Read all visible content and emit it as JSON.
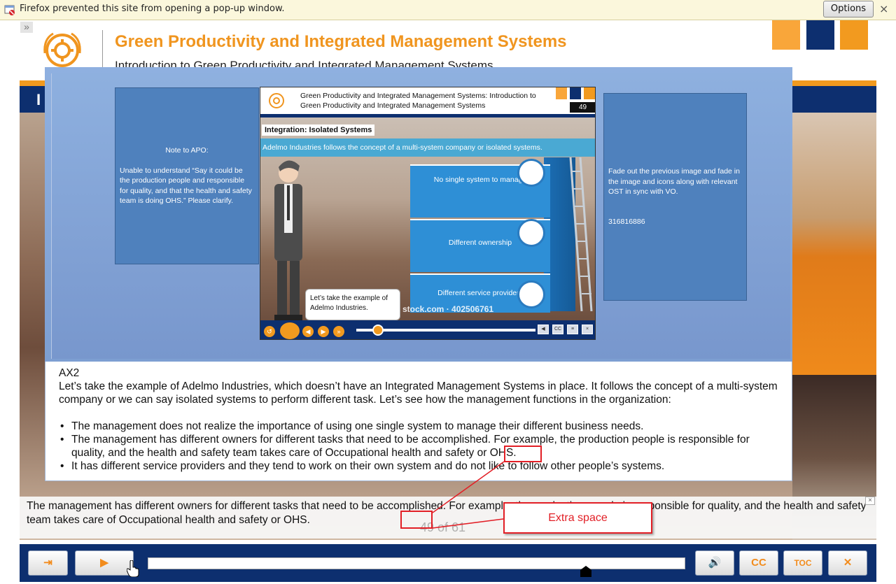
{
  "browser": {
    "notification_text": "Firefox prevented this site from opening a pop-up window.",
    "options_label": "Options",
    "close_glyph": "×"
  },
  "course": {
    "title": "Green Productivity and Integrated Management Systems",
    "subtitle": "Introduction to Green Productivity and Integrated Management Systems",
    "navy_letter": "I",
    "brand_colors": {
      "orange": "#f29a1f",
      "navy": "#0d2f6f",
      "blue": "#4f81bd"
    }
  },
  "review": {
    "note_left": {
      "heading": "Note to APO:",
      "body": "Unable to understand “Say it could be the production people and responsible for quality, and that the health and safety team is doing OHS.” Please clarify."
    },
    "note_right": {
      "body": "Fade out the previous image and fade in the image and icons along with relevant OST in sync with VO.",
      "id": "316816886"
    },
    "slide": {
      "title": "Green Productivity and Integrated Management Systems: Introduction to Green Productivity and Integrated Management Systems",
      "page_number": "49",
      "heading": "Integration: Isolated Systems",
      "banner": "Adelmo Industries follows the concept of a multi-system company or isolated systems.",
      "stack_items": [
        {
          "label": "No single system to manage",
          "icon": "eye-icon"
        },
        {
          "label": "Different ownership",
          "icon": "people-icon"
        },
        {
          "label": "Different service providers",
          "icon": "network-icon"
        }
      ],
      "speech": "Let’s take the example of Adelmo Industries.",
      "watermark": "stock.com · 402506761",
      "progress": 0.12
    },
    "narration": {
      "id": "AX2",
      "intro": "Let’s take the example of Adelmo Industries, which doesn’t have an Integrated Management Systems in place. It follows the concept of a multi-system company or we can say isolated systems to perform different task. Let’s see how the management functions in the organization:",
      "bullets": [
        "The management does not realize the importance of using one single system to manage their different business needs.",
        "The management has different owners for different tasks that need to be accomplished. For example, the production people is responsible for quality, and the health and safety team takes care of Occupational health and safety or OHS.",
        "It has different service providers and they tend to work on their own system and do not like to follow other people’s systems."
      ]
    }
  },
  "caption": {
    "text": "The management has different owners for different tasks that need to be accomplished. For example, the production people is responsible for quality, and the health and safety team takes care of Occupational health and safety or OHS.",
    "ghost_page": "49 of 61"
  },
  "annotation": {
    "label": "Extra space"
  },
  "player": {
    "exit_label": "⇥",
    "play_label": "▶",
    "volume_label": "🔊",
    "cc_label": "CC",
    "toc_label": "TOC",
    "close_label": "✕",
    "progress": 0.81
  }
}
